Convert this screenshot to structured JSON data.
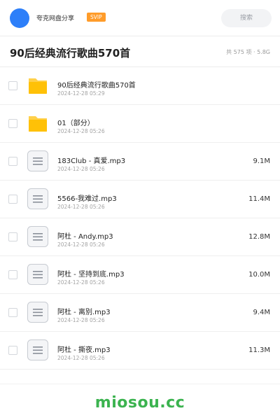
{
  "topbar": {
    "user_name": "夸克网盘分享",
    "badge": "SVIP",
    "search_label": "搜索",
    "avatar_color": "#2d7ff9",
    "badge_color": "#ff9c2a"
  },
  "header": {
    "title": "90后经典流行歌曲570首",
    "meta": "共 575 项 · 5.8G"
  },
  "files": [
    {
      "name": "90后经典流行歌曲570首",
      "date": "2024-12-28 05:29",
      "size": "",
      "type": "folder"
    },
    {
      "name": "01（部分）",
      "date": "2024-12-28 05:26",
      "size": "",
      "type": "folder"
    },
    {
      "name": "183Club - 真爱.mp3",
      "date": "2024-12-28 05:26",
      "size": "9.1M",
      "type": "file"
    },
    {
      "name": "5566-我难过.mp3",
      "date": "2024-12-28 05:26",
      "size": "11.4M",
      "type": "file"
    },
    {
      "name": "阿杜 - Andy.mp3",
      "date": "2024-12-28 05:26",
      "size": "12.8M",
      "type": "file"
    },
    {
      "name": "阿杜 - 坚持到底.mp3",
      "date": "2024-12-28 05:26",
      "size": "10.0M",
      "type": "file"
    },
    {
      "name": "阿杜 - 离别.mp3",
      "date": "2024-12-28 05:26",
      "size": "9.4M",
      "type": "file"
    },
    {
      "name": "阿杜 - 撕夜.mp3",
      "date": "2024-12-28 05:26",
      "size": "11.3M",
      "type": "file"
    }
  ],
  "watermark": "miosou.cc",
  "watermark_color": "#3bb34f"
}
